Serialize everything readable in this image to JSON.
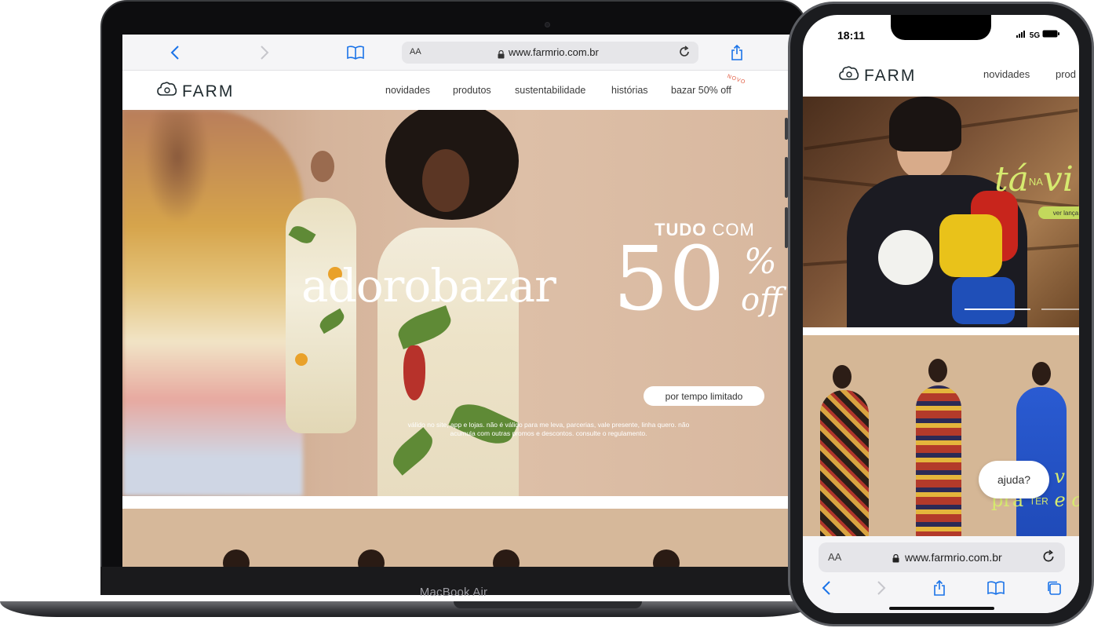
{
  "mac": {
    "device_label": "MacBook Air",
    "browser": {
      "aa_label": "AA",
      "url": "www.farmrio.com.br"
    },
    "site": {
      "logo_text": "FARM",
      "nav": [
        "novidades",
        "produtos",
        "sustentabilidade",
        "histórias",
        "bazar 50% off"
      ],
      "nav_badge": "novo"
    },
    "hero": {
      "title_light": "adoro",
      "title_bold": "bazar",
      "tudo_bold": "TUDO",
      "tudo_light": "COM",
      "big_number": "50",
      "percent": "%",
      "off": "off",
      "button_label": "por tempo limitado",
      "legal_text": "válido no site, app e lojas. não é válido para me leva, parcerias, vale presente, linha quero. não acumula com outras promos e descontos. consulte o regulamento.",
      "carousel_active_index": 1,
      "carousel_count": 3
    }
  },
  "phone": {
    "status": {
      "time": "18:11",
      "signal": "5G"
    },
    "site": {
      "logo_text": "FARM",
      "nav": [
        "novidades",
        "prod"
      ]
    },
    "hero1": {
      "headline": "tá",
      "headline_small": "NA",
      "headline_tail": "vi",
      "button_label": "ver lança"
    },
    "hero2": {
      "overlay_line1": "os v",
      "overlay_line2_a": "pra",
      "overlay_line2_small": "TER",
      "overlay_line2_b": "e c"
    },
    "help_button": "ajuda?",
    "browser": {
      "aa_label": "AA",
      "url": "www.farmrio.com.br"
    }
  },
  "colors": {
    "safari_blue": "#1a73e8",
    "brand_lime": "#d6ea6f",
    "hero_beige": "#ddbfa7"
  }
}
